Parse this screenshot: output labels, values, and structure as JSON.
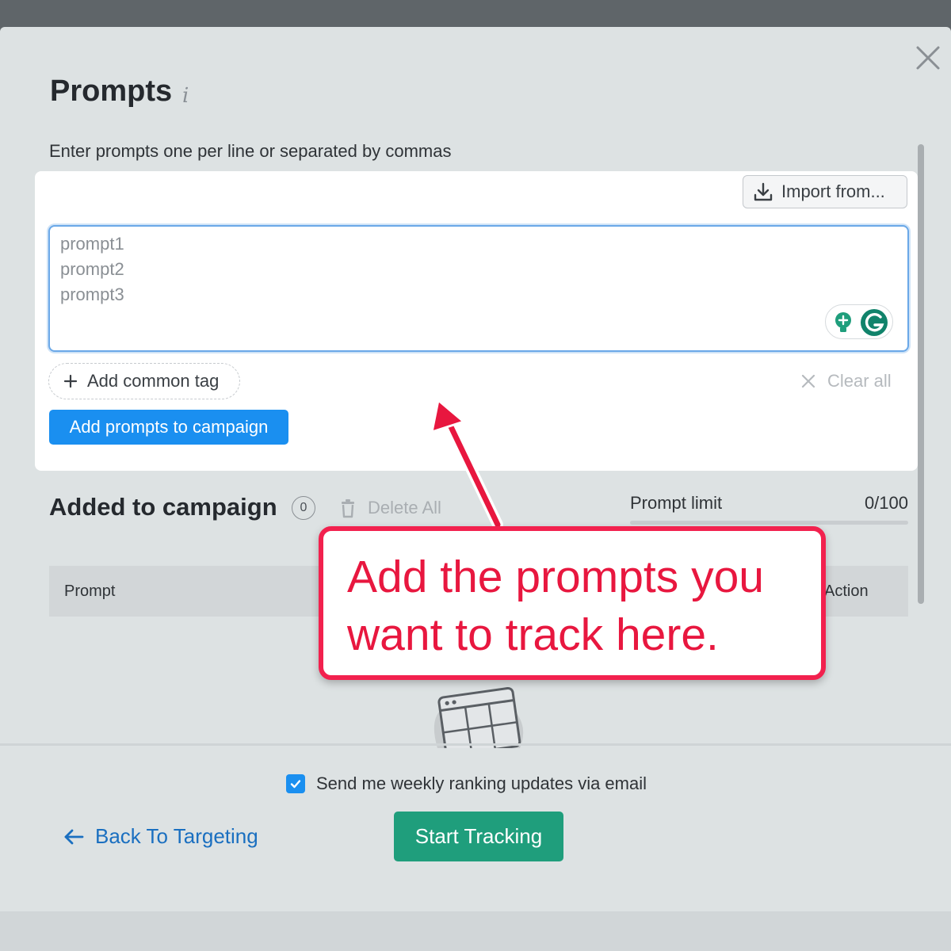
{
  "modal": {
    "title": "Prompts",
    "info_icon_glyph": "i",
    "instructions": "Enter prompts one per line or separated by commas",
    "close_icon": "close-icon"
  },
  "input_card": {
    "import_label": "Import from...",
    "import_icon": "download-icon",
    "textarea_lines": [
      "prompt1",
      "prompt2",
      "prompt3"
    ],
    "add_tag_label": "Add common tag",
    "clear_all_label": "Clear all",
    "add_prompts_label": "Add prompts to campaign"
  },
  "campaign": {
    "title": "Added to campaign",
    "count": "0",
    "delete_all_label": "Delete All",
    "prompt_limit_label": "Prompt limit",
    "prompt_limit_value": "0/100",
    "prompt_limit_fraction": 0,
    "table_columns": [
      "Prompt",
      "Action"
    ]
  },
  "footer": {
    "email_checkbox_checked": true,
    "email_label": "Send me weekly ranking updates via email",
    "back_label": "Back To Targeting",
    "start_label": "Start Tracking"
  },
  "annotation": {
    "line1": "Add the prompts you",
    "line2": "want to track here."
  },
  "colors": {
    "primary_blue": "#1a8ff0",
    "start_green": "#1f9e7c",
    "callout_red": "#f2214e",
    "link_blue": "#1a6fc0"
  }
}
